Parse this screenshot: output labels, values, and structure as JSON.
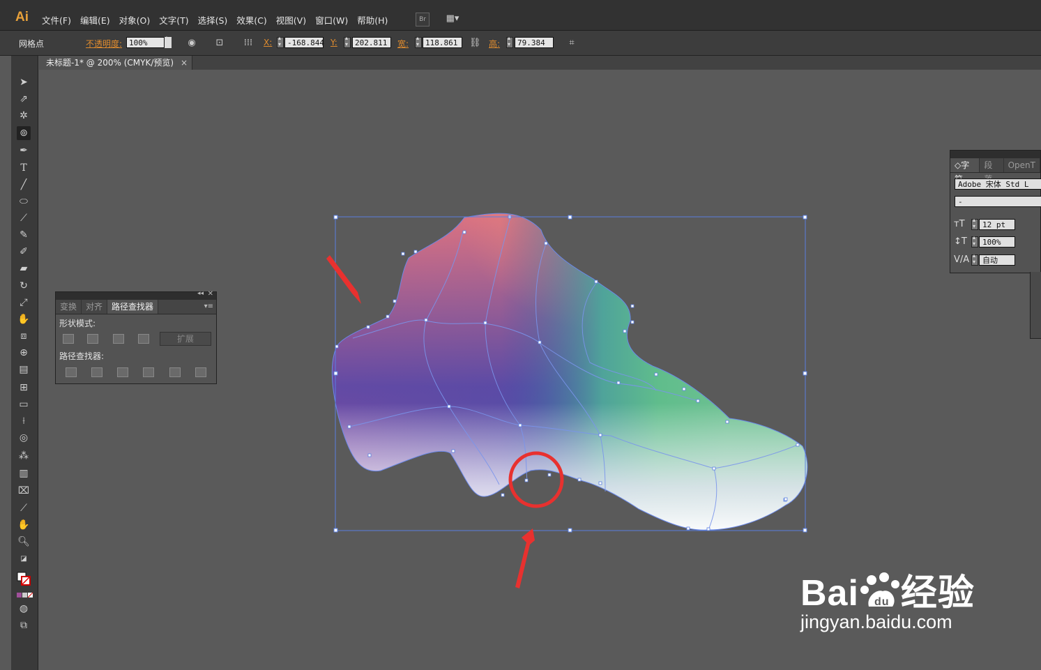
{
  "app": {
    "logo": "Ai"
  },
  "menu": [
    "文件(F)",
    "编辑(E)",
    "对象(O)",
    "文字(T)",
    "选择(S)",
    "效果(C)",
    "视图(V)",
    "窗口(W)",
    "帮助(H)"
  ],
  "menu_buttons": {
    "bridge": "Br",
    "arrange": "▦▾"
  },
  "control": {
    "object_label": "网格点",
    "opacity_label": "不透明度:",
    "opacity_value": "100%",
    "x_label": "X:",
    "x_value": "-168.844",
    "y_label": "Y:",
    "y_value": "202.811",
    "w_label": "宽:",
    "w_value": "118.861",
    "h_label": "高:",
    "h_value": "79.384"
  },
  "document_tab": {
    "title": "未标题-1* @ 200% (CMYK/预览)",
    "close": "×"
  },
  "pathfinder_panel": {
    "tabs": [
      "变换",
      "对齐",
      "路径查找器"
    ],
    "active_tab": "路径查找器",
    "shape_modes_label": "形状模式:",
    "expand_label": "扩展",
    "pathfinders_label": "路径查找器:"
  },
  "character_panel": {
    "tabs": [
      "字符",
      "段落",
      "OpenT"
    ],
    "font_family": "Adobe 宋体 Std L",
    "font_style": "-",
    "font_size": "12 pt",
    "scale": "100%",
    "kerning": "自动"
  },
  "watermark": {
    "main": "Bai",
    "brand": "经验",
    "url": "jingyan.baidu.com"
  },
  "colors": {
    "accent_red": "#e8312f",
    "selection": "#5a7fe0",
    "logo": "#e8a13a"
  }
}
